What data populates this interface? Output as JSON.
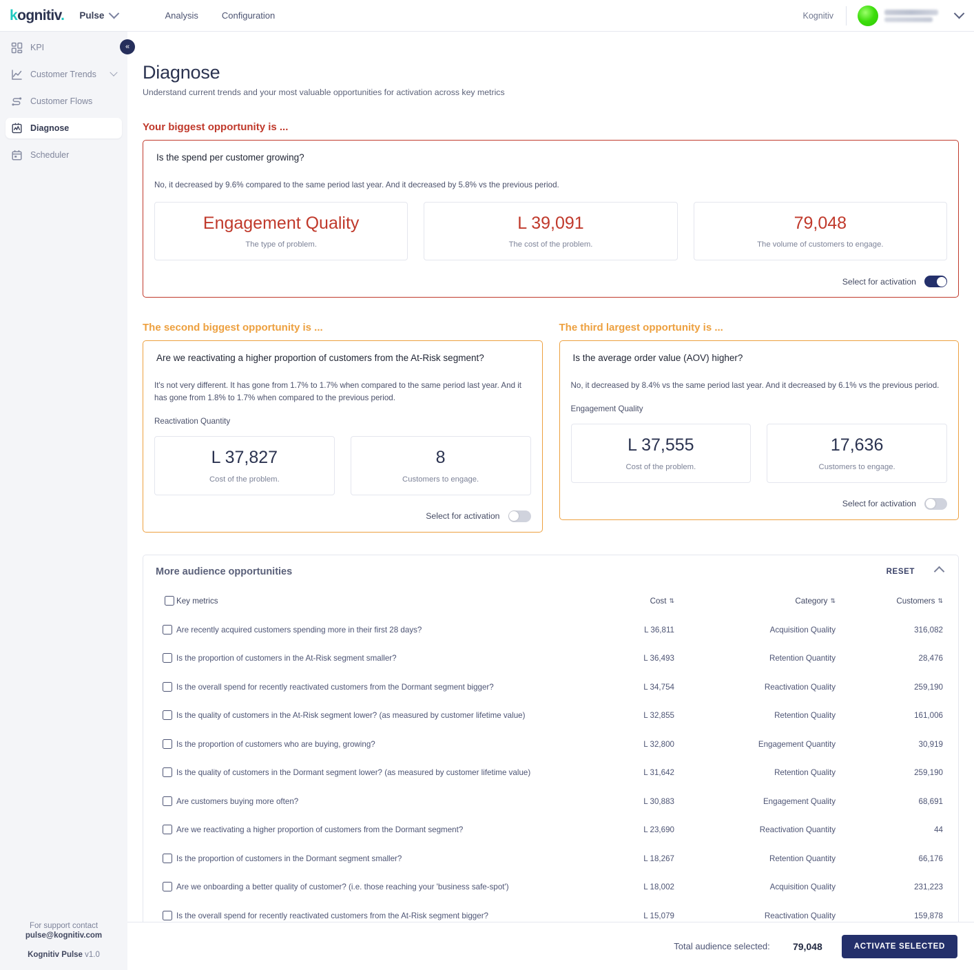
{
  "topbar": {
    "logo_k": "k",
    "logo_rest": "ognitiv",
    "logo_dot": ".",
    "app_name": "Pulse",
    "nav": [
      {
        "label": "Analysis"
      },
      {
        "label": "Configuration"
      }
    ],
    "org": "Kognitiv"
  },
  "sidebar": {
    "items": [
      {
        "label": "KPI",
        "icon": "grid-icon",
        "active": false,
        "expandable": false
      },
      {
        "label": "Customer Trends",
        "icon": "line-chart-icon",
        "active": false,
        "expandable": true
      },
      {
        "label": "Customer Flows",
        "icon": "flow-icon",
        "active": false,
        "expandable": false
      },
      {
        "label": "Diagnose",
        "icon": "diagnose-icon",
        "active": true,
        "expandable": false
      },
      {
        "label": "Scheduler",
        "icon": "calendar-icon",
        "active": false,
        "expandable": false
      }
    ],
    "collapse_glyph": "«",
    "footer": {
      "support_line": "For support contact",
      "support_email": "pulse@kognitiv.com",
      "product": "Kognitiv Pulse",
      "version": "v1.0"
    }
  },
  "page": {
    "title": "Diagnose",
    "subtitle": "Understand current trends and your most valuable opportunities for activation across key metrics"
  },
  "colors": {
    "primary_red": "#c0392b",
    "secondary_orange": "#eda03f",
    "navy": "#24306b",
    "teal": "#1fc8c0"
  },
  "opportunities": {
    "first": {
      "heading": "Your biggest opportunity is ...",
      "question": "Is the spend per customer growing?",
      "answer": "No, it decreased by 9.6% compared to the same period last year. And it decreased by 5.8% vs the previous period.",
      "tiles": [
        {
          "value": "Engagement Quality",
          "caption": "The type of problem."
        },
        {
          "value": "L 39,091",
          "caption": "The cost of the problem."
        },
        {
          "value": "79,048",
          "caption": "The volume of customers to engage."
        }
      ],
      "activation_label": "Select for activation",
      "activation_on": true
    },
    "second": {
      "heading": "The second biggest opportunity is ...",
      "question": "Are we reactivating a higher proportion of customers from the At-Risk segment?",
      "answer": "It's not very different. It has gone from 1.7% to 1.7% when compared to the same period last year. And it has gone from 1.8% to 1.7% when compared to the previous period.",
      "category": "Reactivation Quantity",
      "tiles": [
        {
          "value": "L 37,827",
          "caption": "Cost of the problem."
        },
        {
          "value": "8",
          "caption": "Customers to engage."
        }
      ],
      "activation_label": "Select for activation",
      "activation_on": false
    },
    "third": {
      "heading": "The third largest opportunity is ...",
      "question": "Is the average order value (AOV) higher?",
      "answer": "No, it decreased by 8.4% vs the same period last year. And it decreased by 6.1% vs the previous period.",
      "category": "Engagement Quality",
      "tiles": [
        {
          "value": "L 37,555",
          "caption": "Cost of the problem."
        },
        {
          "value": "17,636",
          "caption": "Customers to engage."
        }
      ],
      "activation_label": "Select for activation",
      "activation_on": false
    }
  },
  "table": {
    "title": "More audience opportunities",
    "reset_label": "RESET",
    "columns": {
      "metric": "Key metrics",
      "cost": "Cost",
      "category": "Category",
      "customers": "Customers"
    },
    "rows": [
      {
        "metric": "Are recently acquired customers spending more in their first 28 days?",
        "cost": "L 36,811",
        "category": "Acquisition Quality",
        "customers": "316,082"
      },
      {
        "metric": "Is the proportion of customers in the At-Risk segment smaller?",
        "cost": "L 36,493",
        "category": "Retention Quantity",
        "customers": "28,476"
      },
      {
        "metric": "Is the overall spend for recently reactivated customers from the Dormant segment bigger?",
        "cost": "L 34,754",
        "category": "Reactivation Quality",
        "customers": "259,190"
      },
      {
        "metric": "Is the quality of customers in the At-Risk segment lower? (as measured by customer lifetime value)",
        "cost": "L 32,855",
        "category": "Retention Quality",
        "customers": "161,006"
      },
      {
        "metric": "Is the proportion of customers who are buying, growing?",
        "cost": "L 32,800",
        "category": "Engagement Quantity",
        "customers": "30,919"
      },
      {
        "metric": "Is the quality of customers in the Dormant segment lower? (as measured by customer lifetime value)",
        "cost": "L 31,642",
        "category": "Retention Quality",
        "customers": "259,190"
      },
      {
        "metric": "Are customers buying more often?",
        "cost": "L 30,883",
        "category": "Engagement Quality",
        "customers": "68,691"
      },
      {
        "metric": "Are we reactivating a higher proportion of customers from the Dormant segment?",
        "cost": "L 23,690",
        "category": "Reactivation Quantity",
        "customers": "44"
      },
      {
        "metric": "Is the proportion of customers in the Dormant segment smaller?",
        "cost": "L 18,267",
        "category": "Retention Quantity",
        "customers": "66,176"
      },
      {
        "metric": "Are we onboarding a better quality of customer? (i.e. those reaching your 'business safe-spot')",
        "cost": "L 18,002",
        "category": "Acquisition Quality",
        "customers": "231,223"
      },
      {
        "metric": "Is the overall spend for recently reactivated customers from the At-Risk segment bigger?",
        "cost": "L 15,079",
        "category": "Reactivation Quality",
        "customers": "159,878"
      }
    ]
  },
  "bottombar": {
    "total_label": "Total audience selected:",
    "total_value": "79,048",
    "activate_label": "ACTIVATE SELECTED"
  }
}
